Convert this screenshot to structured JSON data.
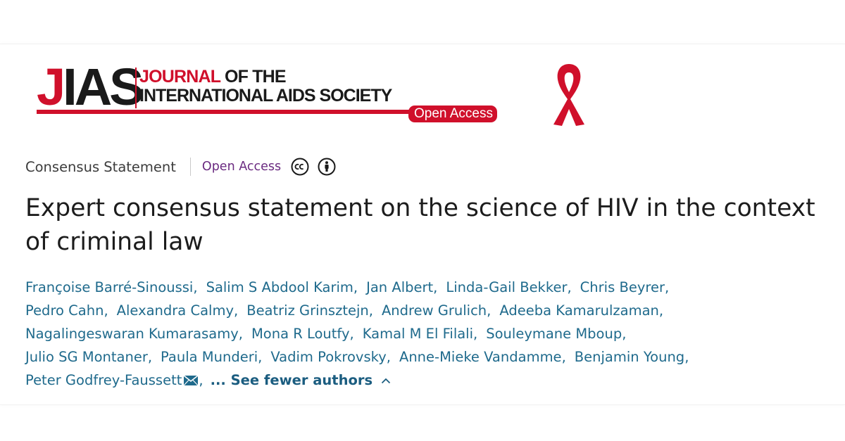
{
  "logo": {
    "j": "J",
    "ias": "IAS",
    "journal_red": "JOURNAL",
    "journal_rest": " OF THE",
    "line2": "INTERNATIONAL AIDS SOCIETY",
    "badge": "Open Access"
  },
  "article": {
    "type": "Consensus Statement",
    "access": "Open Access",
    "title": "Expert consensus statement on the science of HIV in the context of criminal law"
  },
  "authors": [
    [
      "Françoise Barré-Sinoussi",
      "Salim S Abdool Karim",
      "Jan Albert",
      "Linda-Gail Bekker",
      "Chris Beyrer"
    ],
    [
      "Pedro Cahn",
      "Alexandra Calmy",
      "Beatriz Grinsztejn",
      "Andrew Grulich",
      "Adeeba Kamarulzaman"
    ],
    [
      "Nagalingeswaran Kumarasamy",
      "Mona R Loutfy",
      "Kamal M El Filali",
      "Souleymane Mboup"
    ],
    [
      "Julio SG Montaner",
      "Paula Munderi",
      "Vadim Pokrovsky",
      "Anne-Mieke Vandamme",
      "Benjamin Young"
    ],
    [
      "Peter Godfrey-Faussett"
    ]
  ],
  "see_fewer": "... See fewer authors",
  "icons": {
    "cc": "creative-commons-icon",
    "by": "attribution-icon",
    "mail": "envelope-icon",
    "chevron": "chevron-up-icon",
    "ribbon": "red-ribbon-icon"
  },
  "colors": {
    "brand_red": "#d0102b",
    "open_access_purple": "#6a2a80",
    "author_link": "#1f6a8c"
  }
}
